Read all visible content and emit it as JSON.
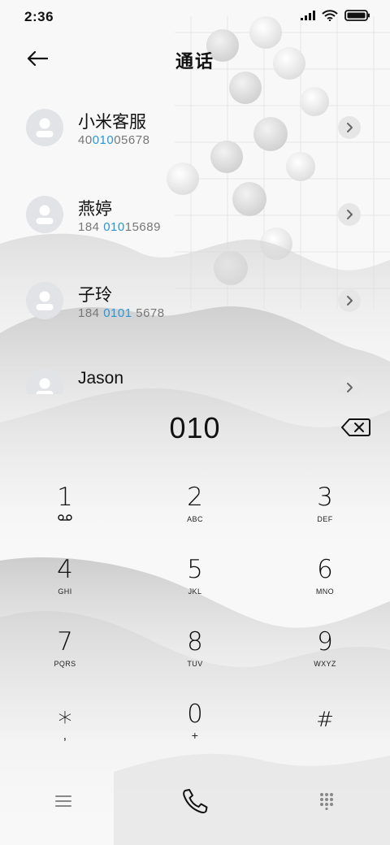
{
  "status_bar": {
    "time": "2:36"
  },
  "header": {
    "title": "通话"
  },
  "contacts": [
    {
      "name": "小米客服",
      "number_parts": [
        {
          "text": "40",
          "hl": false
        },
        {
          "text": "010",
          "hl": true
        },
        {
          "text": "05678",
          "hl": false
        }
      ]
    },
    {
      "name": "燕婷",
      "number_parts": [
        {
          "text": "184 ",
          "hl": false
        },
        {
          "text": "010",
          "hl": true
        },
        {
          "text": "15689",
          "hl": false
        }
      ]
    },
    {
      "name": "子玲",
      "number_parts": [
        {
          "text": "184 ",
          "hl": false
        },
        {
          "text": "0101",
          "hl": true
        },
        {
          "text": " 5678",
          "hl": false
        }
      ]
    },
    {
      "name": "Jason",
      "number_parts": []
    }
  ],
  "dial": {
    "number": "010"
  },
  "keypad": [
    {
      "digit": "1",
      "letters": "",
      "sub_icon": "voicemail-icon"
    },
    {
      "digit": "2",
      "letters": "ABC"
    },
    {
      "digit": "3",
      "letters": "DEF"
    },
    {
      "digit": "4",
      "letters": "GHI"
    },
    {
      "digit": "5",
      "letters": "JKL"
    },
    {
      "digit": "6",
      "letters": "MNO"
    },
    {
      "digit": "7",
      "letters": "PQRS"
    },
    {
      "digit": "8",
      "letters": "TUV"
    },
    {
      "digit": "9",
      "letters": "WXYZ"
    },
    {
      "digit": "*",
      "letters": ","
    },
    {
      "digit": "0",
      "letters": "+"
    },
    {
      "digit": "#",
      "letters": ""
    }
  ],
  "bottom_bar": {
    "icons": [
      "menu-icon",
      "phone-call-icon",
      "dialpad-icon"
    ]
  },
  "colors": {
    "highlight": "#2b96d6",
    "text": "#111111",
    "muted": "#777777"
  }
}
